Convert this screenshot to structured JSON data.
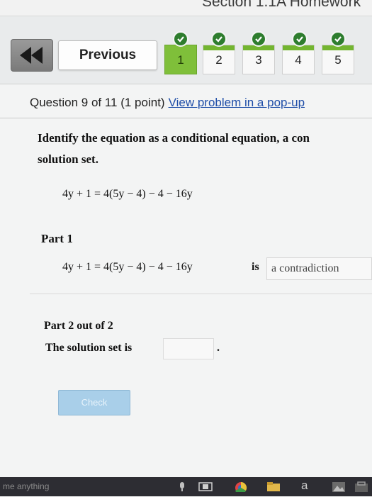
{
  "window": {
    "title": "Section 1.1A Homework"
  },
  "nav": {
    "previous_label": "Previous",
    "questions": [
      {
        "label": "1",
        "completed": true,
        "current": true
      },
      {
        "label": "2",
        "completed": true,
        "current": false
      },
      {
        "label": "3",
        "completed": true,
        "current": false
      },
      {
        "label": "4",
        "completed": true,
        "current": false
      },
      {
        "label": "5",
        "completed": true,
        "current": false
      }
    ]
  },
  "question": {
    "header": "Question 9 of 11 (1 point)",
    "popup_link": "View problem in a pop-up",
    "instruction_line1": "Identify the equation as a conditional equation, a con",
    "instruction_line2": "solution set.",
    "equation": "4y + 1 = 4(5y − 4) − 4 − 16y"
  },
  "part1": {
    "title": "Part 1",
    "equation": "4y + 1 = 4(5y − 4) − 4 − 16y",
    "is_word": "is",
    "answer": "a contradiction"
  },
  "part2": {
    "title": "Part 2 out of 2",
    "solution_label": "The solution set is",
    "solution_value": "",
    "period": "."
  },
  "submit_label": "Check",
  "taskbar": {
    "search_placeholder": "me anything",
    "letter_a": "a"
  },
  "colors": {
    "accent_green": "#73b530",
    "check_green": "#2e7d2e",
    "link_blue": "#1f4ea8",
    "submit_blue": "#a9cfe9"
  }
}
